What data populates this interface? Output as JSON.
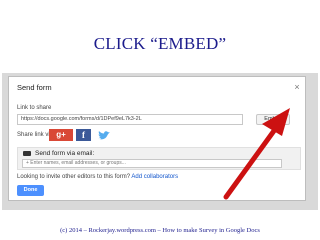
{
  "slide": {
    "title": "CLICK “EMBED”",
    "footer": "(c) 2014 – Rockerjay.wordpress.com – How to make Survey in Google Docs"
  },
  "dialog": {
    "title": "Send form",
    "link_label": "Link to share",
    "link_value": "https://docs.google.com/forms/d/1DPef9eL7k3-2L",
    "embed_label": "Embed",
    "share_label": "Share link via",
    "social": [
      "g+",
      "f"
    ],
    "email_section_label": "Send form via email:",
    "email_placeholder": "+ Enter names, email addresses, or groups...",
    "invite_text": "Looking to invite other editors to this form?",
    "add_collaborators": "Add collaborators",
    "done_label": "Done",
    "close_glyph": "×"
  },
  "colors": {
    "title": "#1c1c8c",
    "arrow": "#cc1111",
    "done": "#4d90fe",
    "gplus": "#d94836",
    "facebook": "#3b5998"
  },
  "icons": [
    "close-icon",
    "google-plus-icon",
    "facebook-icon",
    "twitter-icon",
    "mail-icon",
    "arrow-icon"
  ]
}
